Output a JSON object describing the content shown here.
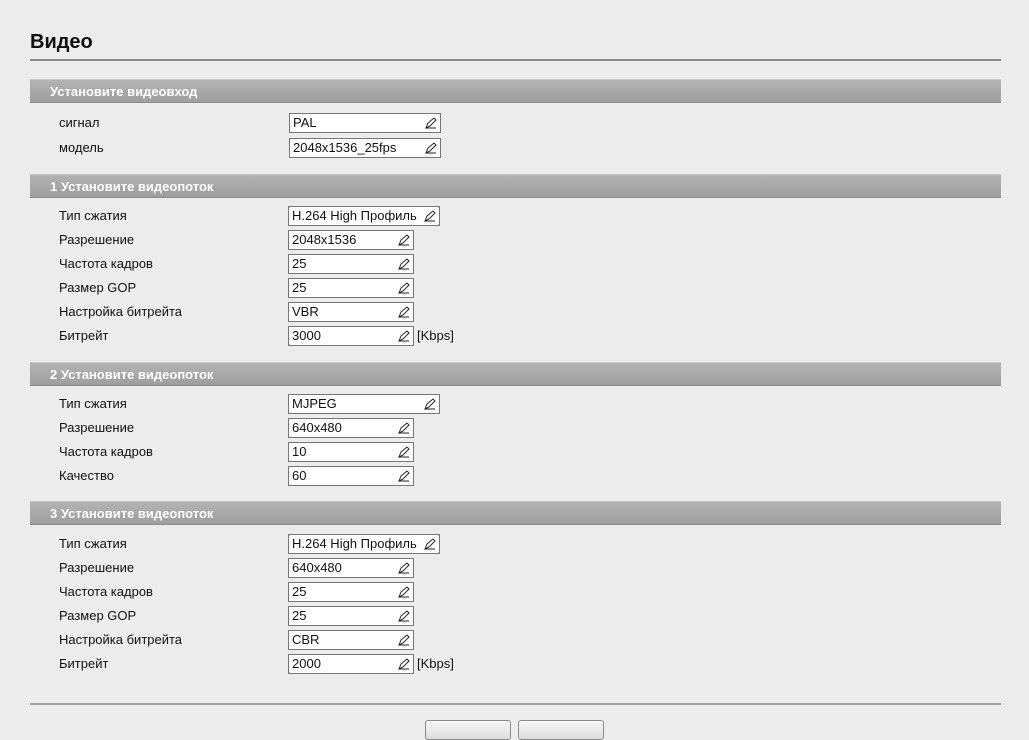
{
  "page": {
    "title": "Видео"
  },
  "sections": [
    {
      "id": "video-input",
      "header": "Установите видеовход",
      "fields": [
        {
          "name": "signal",
          "label": "сигнал",
          "value": "PAL"
        },
        {
          "name": "model",
          "label": "модель",
          "value": "2048x1536_25fps"
        }
      ]
    },
    {
      "id": "stream-1",
      "header": "1 Установите видеопоток",
      "fields": [
        {
          "name": "compression",
          "label": "Тип сжатия",
          "value": "H.264 High Профиль"
        },
        {
          "name": "resolution",
          "label": "Разрешение",
          "value": "2048x1536"
        },
        {
          "name": "frame-rate",
          "label": "Частота кадров",
          "value": "25"
        },
        {
          "name": "gop-size",
          "label": "Размер GOP",
          "value": "25"
        },
        {
          "name": "bitrate-control",
          "label": "Настройка битрейта",
          "value": "VBR"
        },
        {
          "name": "bitrate",
          "label": "Битрейт",
          "value": "3000",
          "unit": "[Kbps]"
        }
      ]
    },
    {
      "id": "stream-2",
      "header": "2 Установите видеопоток",
      "fields": [
        {
          "name": "compression",
          "label": "Тип сжатия",
          "value": "MJPEG"
        },
        {
          "name": "resolution",
          "label": "Разрешение",
          "value": "640x480"
        },
        {
          "name": "frame-rate",
          "label": "Частота кадров",
          "value": "10"
        },
        {
          "name": "quality",
          "label": "Качество",
          "value": "60"
        }
      ]
    },
    {
      "id": "stream-3",
      "header": "3 Установите видеопоток",
      "fields": [
        {
          "name": "compression",
          "label": "Тип сжатия",
          "value": "H.264 High Профиль"
        },
        {
          "name": "resolution",
          "label": "Разрешение",
          "value": "640x480"
        },
        {
          "name": "frame-rate",
          "label": "Частота кадров",
          "value": "25"
        },
        {
          "name": "gop-size",
          "label": "Размер GOP",
          "value": "25"
        },
        {
          "name": "bitrate-control",
          "label": "Настройка битрейта",
          "value": "CBR"
        },
        {
          "name": "bitrate",
          "label": "Битрейт",
          "value": "2000",
          "unit": "[Kbps]"
        }
      ]
    }
  ],
  "icons": {
    "dropdown": "pen-dropdown-icon"
  }
}
